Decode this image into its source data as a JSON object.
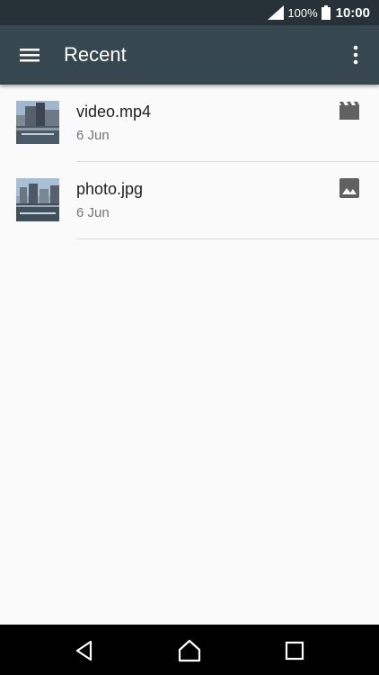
{
  "status_bar": {
    "battery_percent": "100%",
    "time": "10:00",
    "icons": [
      "signal-icon",
      "battery-icon"
    ]
  },
  "app_bar": {
    "title": "Recent",
    "icons": [
      "menu-icon",
      "overflow-menu-icon"
    ],
    "color": "#37474f"
  },
  "files": [
    {
      "name": "video.mp4",
      "date": "6 Jun",
      "type_icon": "video-icon"
    },
    {
      "name": "photo.jpg",
      "date": "6 Jun",
      "type_icon": "image-icon"
    }
  ],
  "nav_bar": {
    "icons": [
      "back-icon",
      "home-icon",
      "recents-icon"
    ]
  }
}
